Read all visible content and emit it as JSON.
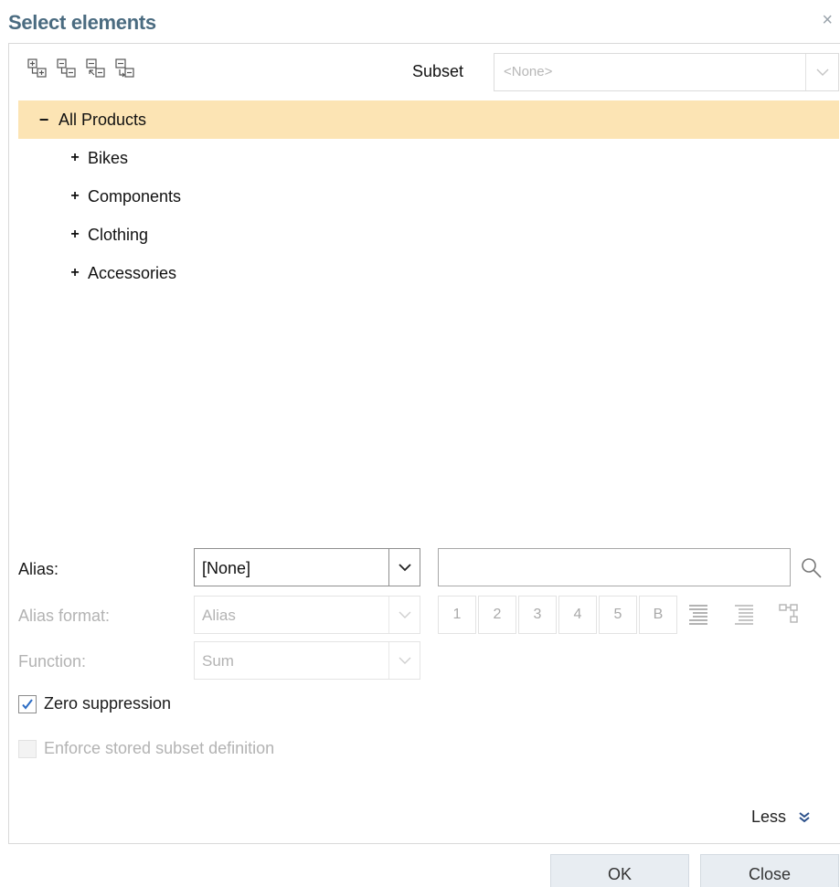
{
  "dialog": {
    "title": "Select elements",
    "close_glyph": "×"
  },
  "toolbar": {
    "icons": [
      "expand-all-icon",
      "collapse-all-icon",
      "expand-selected-icon",
      "collapse-selected-icon"
    ],
    "subset_label": "Subset",
    "subset_value": "<None>"
  },
  "tree": {
    "items": [
      {
        "label": "All Products",
        "toggle": "−",
        "level": 0,
        "selected": true
      },
      {
        "label": "Bikes",
        "toggle": "+",
        "level": 1
      },
      {
        "label": "Components",
        "toggle": "+",
        "level": 1
      },
      {
        "label": "Clothing",
        "toggle": "+",
        "level": 1
      },
      {
        "label": "Accessories",
        "toggle": "+",
        "level": 1
      }
    ]
  },
  "alias": {
    "label": "Alias:",
    "value": "[None]",
    "search_value": ""
  },
  "alias_format": {
    "label": "Alias format:",
    "value": "Alias",
    "buttons": [
      "1",
      "2",
      "3",
      "4",
      "5",
      "B"
    ]
  },
  "function": {
    "label": "Function:",
    "value": "Sum"
  },
  "zero_suppression": {
    "label": "Zero suppression",
    "checked": true
  },
  "enforce": {
    "label": "Enforce stored subset definition",
    "checked": false
  },
  "less_label": "Less",
  "buttons": {
    "ok": "OK",
    "close": "Close"
  },
  "colors": {
    "title": "#4a6b80",
    "selected_row": "#fce4b4",
    "check": "#2b6cc4"
  }
}
